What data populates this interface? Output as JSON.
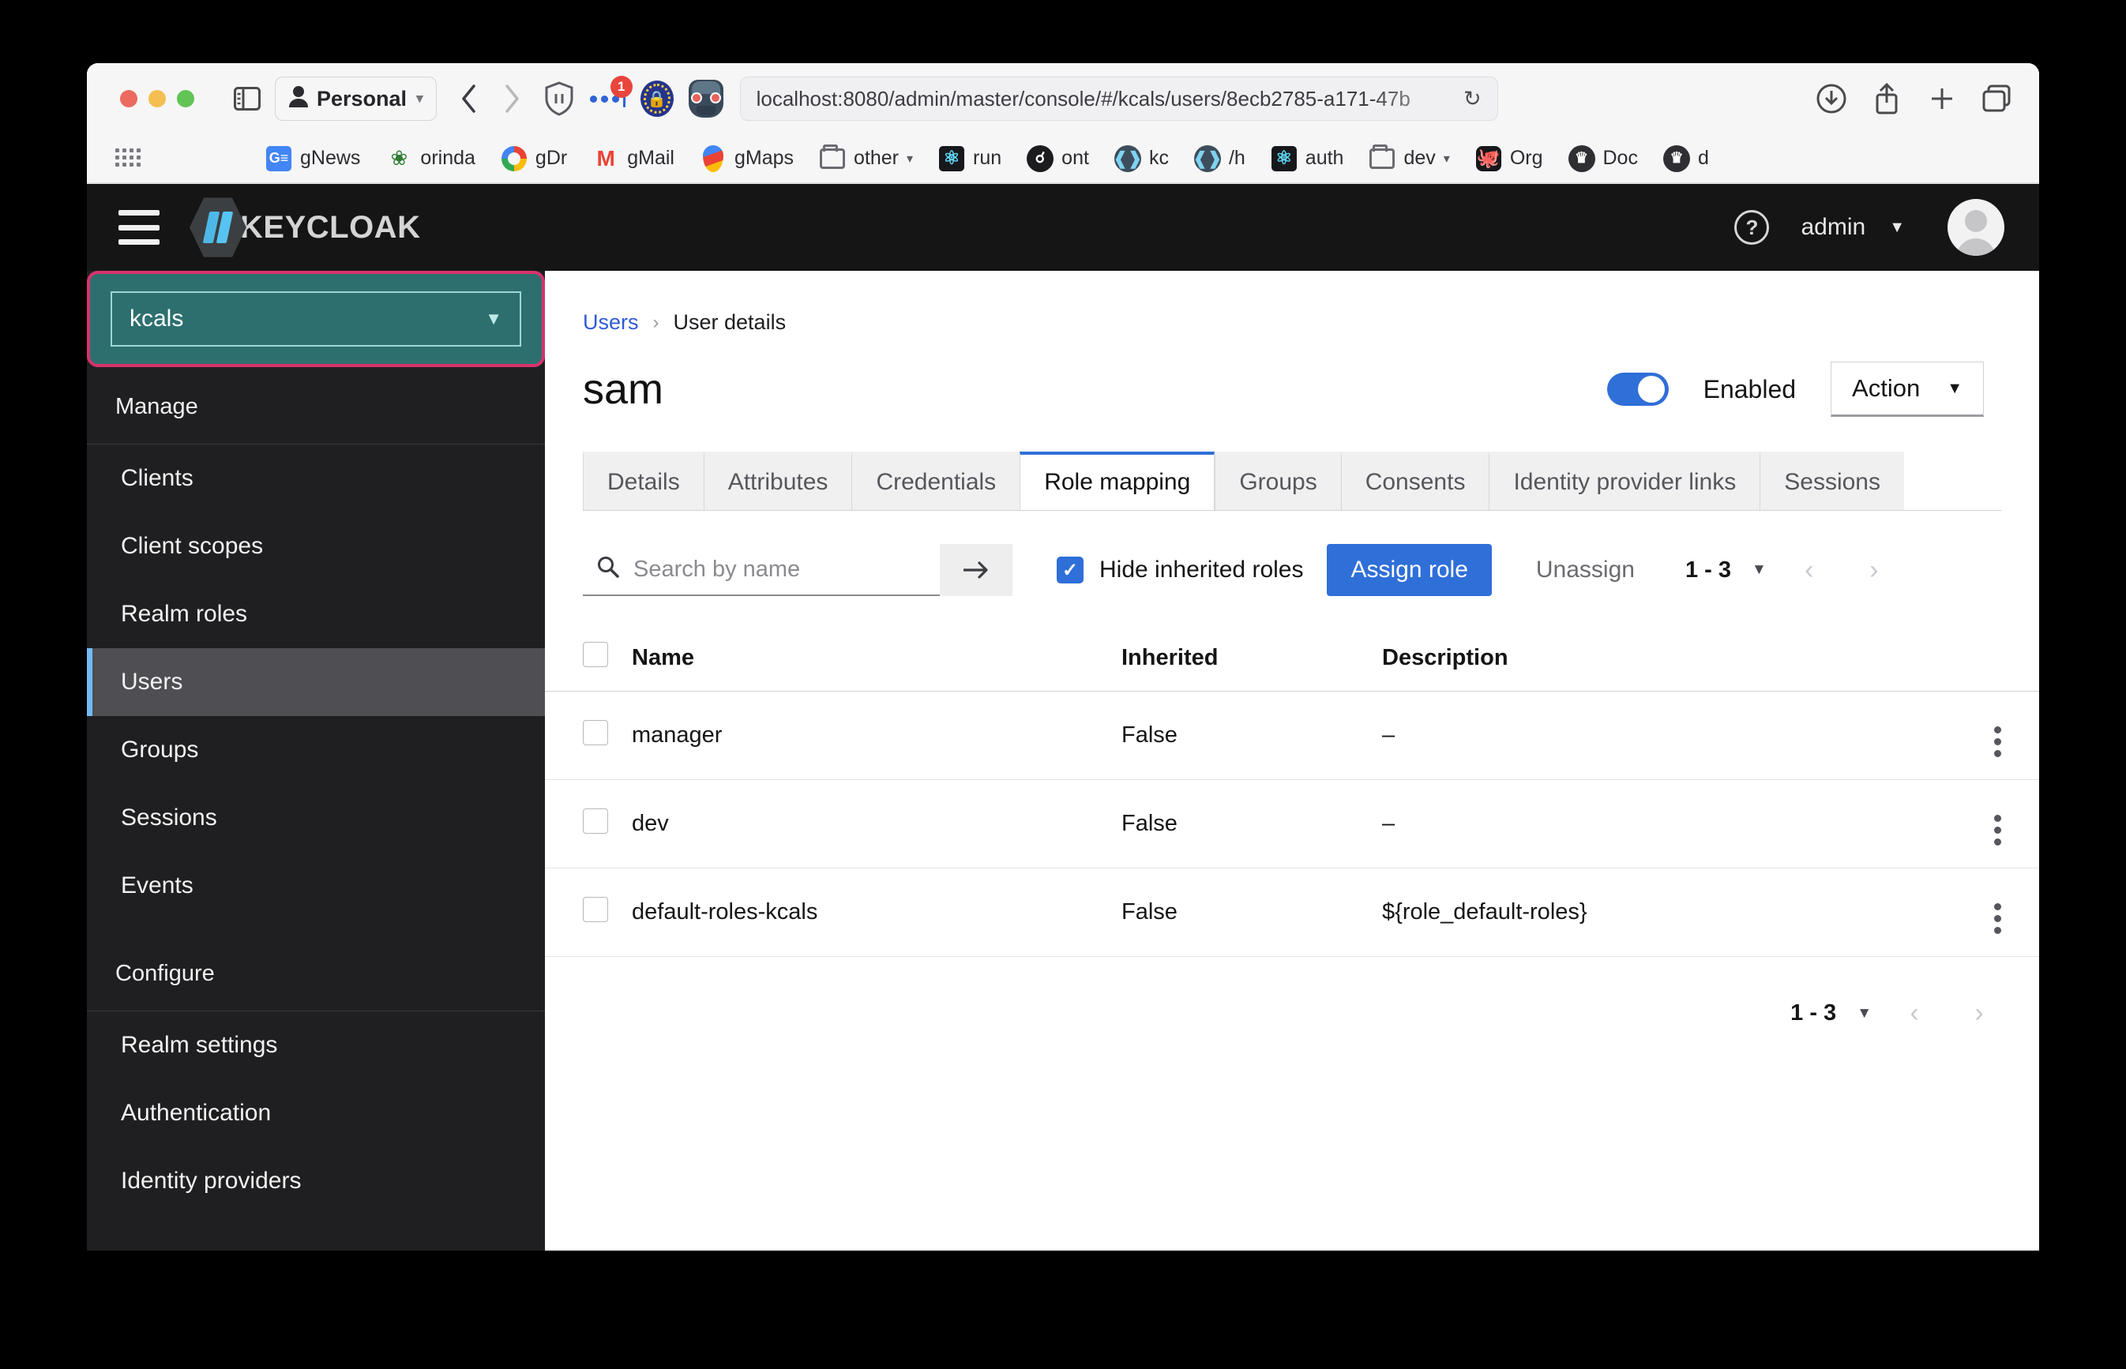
{
  "browser": {
    "profile_label": "Personal",
    "url": "localhost:8080/admin/master/console/#/kcals/users/8ecb2785-a171-47b",
    "extension_badge": "1",
    "bookmarks": [
      {
        "label": "gNews",
        "icon": "google-news-icon"
      },
      {
        "label": "orinda",
        "icon": "orinda-icon"
      },
      {
        "label": "gDr",
        "icon": "google-drive-icon"
      },
      {
        "label": "gMail",
        "icon": "gmail-icon"
      },
      {
        "label": "gMaps",
        "icon": "google-maps-icon"
      },
      {
        "label": "other",
        "icon": "folder-icon",
        "has_caret": true
      },
      {
        "label": "run",
        "icon": "react-icon"
      },
      {
        "label": "ont",
        "icon": "ont-icon"
      },
      {
        "label": "kc",
        "icon": "keycloak-icon"
      },
      {
        "label": "/h",
        "icon": "keycloak-icon"
      },
      {
        "label": "auth",
        "icon": "react-icon"
      },
      {
        "label": "dev",
        "icon": "folder-icon",
        "has_caret": true
      },
      {
        "label": "Org",
        "icon": "github-icon"
      },
      {
        "label": "Doc",
        "icon": "doc-icon"
      },
      {
        "label": "d",
        "icon": "doc-icon"
      }
    ]
  },
  "keycloak": {
    "brand": "KEYCLOAK",
    "help_icon": "help-circle-icon",
    "user_menu_label": "admin"
  },
  "sidebar": {
    "realm": "kcals",
    "manage_label": "Manage",
    "manage_items": [
      {
        "label": "Clients",
        "active": false
      },
      {
        "label": "Client scopes",
        "active": false
      },
      {
        "label": "Realm roles",
        "active": false
      },
      {
        "label": "Users",
        "active": true
      },
      {
        "label": "Groups",
        "active": false
      },
      {
        "label": "Sessions",
        "active": false
      },
      {
        "label": "Events",
        "active": false
      }
    ],
    "configure_label": "Configure",
    "configure_items": [
      {
        "label": "Realm settings"
      },
      {
        "label": "Authentication"
      },
      {
        "label": "Identity providers"
      }
    ]
  },
  "breadcrumb": {
    "root": "Users",
    "separator": "›",
    "current": "User details"
  },
  "page": {
    "title": "sam",
    "enabled_label": "Enabled",
    "action_label": "Action"
  },
  "tabs": [
    {
      "label": "Details",
      "active": false
    },
    {
      "label": "Attributes",
      "active": false
    },
    {
      "label": "Credentials",
      "active": false
    },
    {
      "label": "Role mapping",
      "active": true
    },
    {
      "label": "Groups",
      "active": false
    },
    {
      "label": "Consents",
      "active": false
    },
    {
      "label": "Identity provider links",
      "active": false
    },
    {
      "label": "Sessions",
      "active": false
    }
  ],
  "toolbar": {
    "search_placeholder": "Search by name",
    "search_value": "",
    "hide_inherited_label": "Hide inherited roles",
    "hide_inherited_checked": true,
    "assign_label": "Assign role",
    "unassign_label": "Unassign",
    "page_range": "1 - 3"
  },
  "table": {
    "columns": [
      "Name",
      "Inherited",
      "Description"
    ],
    "rows": [
      {
        "name": "manager",
        "inherited": "False",
        "description": "–"
      },
      {
        "name": "dev",
        "inherited": "False",
        "description": "–"
      },
      {
        "name": "default-roles-kcals",
        "inherited": "False",
        "description": "${role_default-roles}"
      }
    ]
  },
  "bottom_pager": {
    "page_range": "1 - 3"
  },
  "colors": {
    "accent_blue": "#2f6fd8",
    "realm_teal": "#2d6f6f",
    "highlight_pink": "#d6336c",
    "sidebar_bg": "#1f1f21",
    "header_bg": "#151515"
  }
}
